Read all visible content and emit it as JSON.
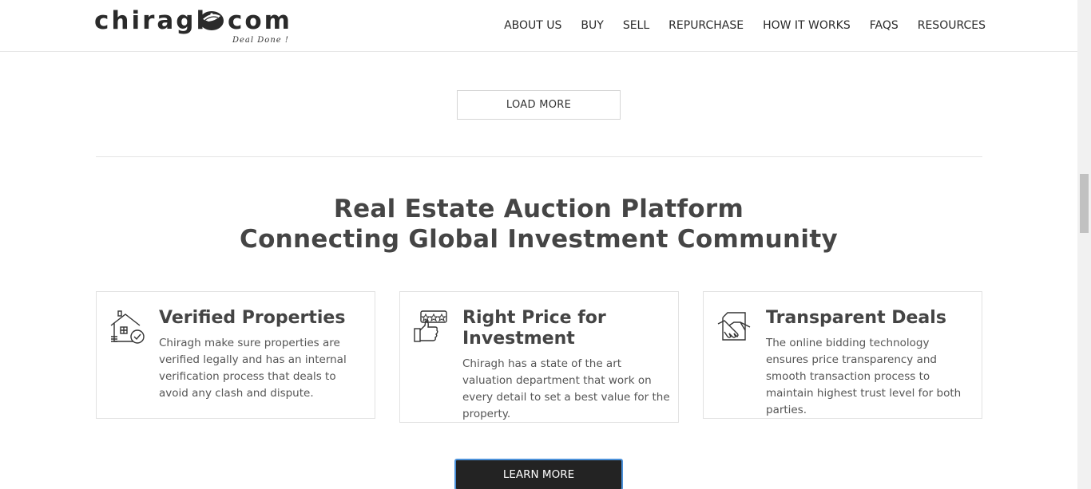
{
  "header": {
    "logo_word1": "chiragh",
    "logo_word2": "com",
    "logo_tagline": "Deal Done !",
    "nav": [
      {
        "label": "ABOUT US"
      },
      {
        "label": "BUY"
      },
      {
        "label": "SELL"
      },
      {
        "label": "REPURCHASE"
      },
      {
        "label": "HOW IT WORKS"
      },
      {
        "label": "FAQS"
      },
      {
        "label": "RESOURCES"
      }
    ]
  },
  "main": {
    "load_more_label": "LOAD MORE",
    "headline_line1": "Real Estate Auction Platform",
    "headline_line2": "Connecting Global Investment Community",
    "cards": [
      {
        "icon": "verified-house-icon",
        "title": "Verified Properties",
        "desc": "Chiragh make sure properties are verified legally and has an internal verification process that deals to avoid any clash and dispute."
      },
      {
        "icon": "thumbs-up-rating-icon",
        "title": "Right Price for Investment",
        "desc": "Chiragh has a state of the art valuation department that work on every detail to set a best value for the property."
      },
      {
        "icon": "handshake-document-icon",
        "title": "Transparent Deals",
        "desc": "The online bidding technology ensures price transparency and smooth transaction process to maintain highest trust level for both parties."
      }
    ],
    "learn_more_label": "LEARN MORE"
  },
  "colors": {
    "text_dark": "#444444",
    "button_dark": "#232323",
    "focus_outline": "#4a90d9",
    "border": "#e2e2e2"
  }
}
